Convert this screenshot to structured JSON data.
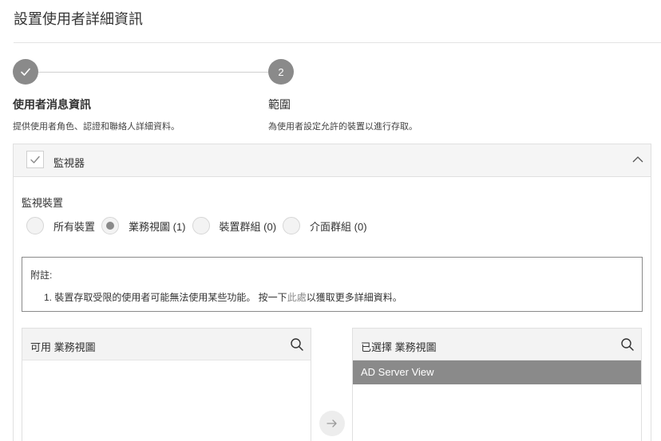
{
  "page": {
    "title": "設置使用者詳細資訊"
  },
  "stepper": {
    "step1": {
      "number": "✓",
      "title": "使用者消息資訊",
      "desc": "提供使用者角色、認證和聯絡人詳細資料。",
      "state": "completed"
    },
    "step2": {
      "number": "2",
      "title": "範圍",
      "desc": "為使用者設定允許的裝置以進行存取。",
      "state": "current"
    }
  },
  "monitor_panel": {
    "title": "監視器",
    "checked": true,
    "expanded": true
  },
  "monitor_devices": {
    "label": "監視裝置",
    "options": [
      {
        "label": "所有裝置",
        "selected": false
      },
      {
        "label": "業務視圖 (1)",
        "selected": true
      },
      {
        "label": "裝置群組 (0)",
        "selected": false
      },
      {
        "label": "介面群組 (0)",
        "selected": false
      }
    ]
  },
  "note": {
    "title": "附註:",
    "text_before": "1. 裝置存取受限的使用者可能無法使用某些功能。 按一下",
    "link": "此處",
    "text_after": "以獲取更多詳細資料。"
  },
  "available_list": {
    "header": "可用 業務視圖",
    "items": []
  },
  "selected_list": {
    "header": "已選擇 業務視圖",
    "items": [
      "AD Server View"
    ]
  },
  "icons": {
    "step_done": "check-icon",
    "collapse": "chevron-up-icon",
    "search": "search-icon",
    "move": "arrow-right-icon"
  },
  "colors": {
    "accent_gray": "#8a8a8a",
    "header_bg": "#f5f5f5",
    "border": "#e0e0e0"
  }
}
